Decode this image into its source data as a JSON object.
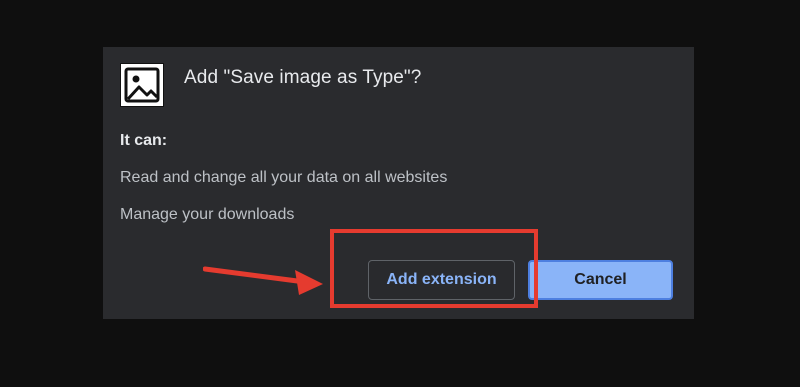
{
  "dialog": {
    "title": "Add \"Save image as Type\"?",
    "icon": "image-icon",
    "permissions_heading": "It can:",
    "permissions": [
      "Read and change all your data on all websites",
      "Manage your downloads"
    ],
    "buttons": {
      "add_label": "Add extension",
      "cancel_label": "Cancel"
    }
  },
  "annotations": {
    "highlight_color": "#e53b2f",
    "arrow_target": "Add extension"
  },
  "colors": {
    "dialog_bg": "#2a2b2e",
    "page_bg": "#0f0f0f",
    "primary_text": "#e8eaed",
    "secondary_text": "#bdc1c6",
    "accent_blue": "#8ab4f8"
  }
}
